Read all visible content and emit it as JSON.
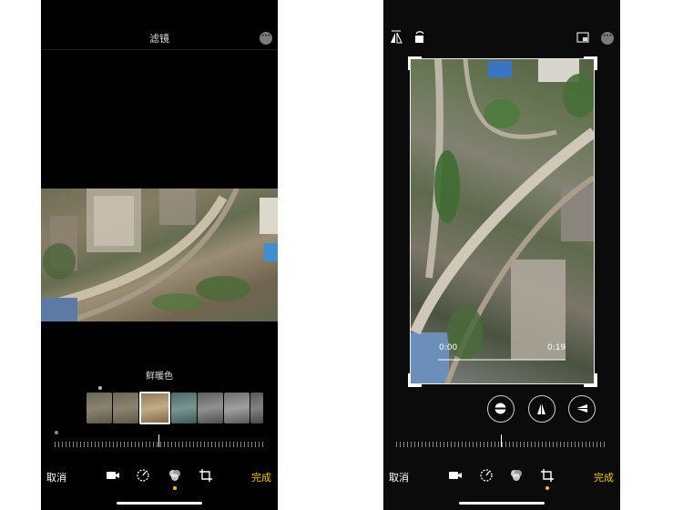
{
  "left": {
    "title": "滤镜",
    "more": "···",
    "filter_name": "鲜暖色",
    "cancel": "取消",
    "done": "完成",
    "filter_thumbnails": 7,
    "selected_thumbnail_index": 2
  },
  "right": {
    "more": "···",
    "start_time": "0:00",
    "end_time": "0:19",
    "cancel": "取消",
    "done": "完成"
  },
  "colors": {
    "accent": "#f5c400",
    "background": "#000000"
  }
}
